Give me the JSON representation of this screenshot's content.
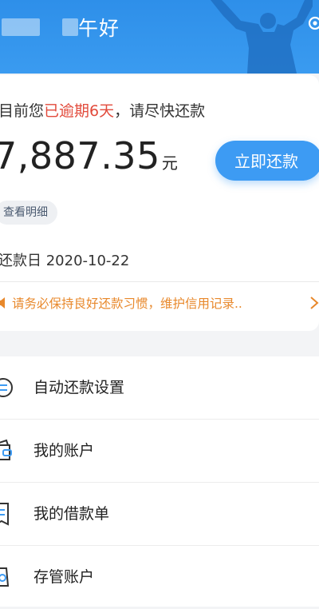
{
  "header": {
    "greeting": "午好"
  },
  "card": {
    "status_prefix": "目前您",
    "status_overdue": "已逾期6天",
    "status_suffix": "，请尽快还款",
    "amount": "7,887.35",
    "amount_unit": "元",
    "pay_button": "立即还款",
    "detail_link": "查看明细",
    "due_date": "还款日 2020-10-22",
    "tip_text": "请务必保持良好还款习惯，维护信用记录.."
  },
  "menu": {
    "items": [
      {
        "label": "自动还款设置",
        "icon": "auto-repay-icon"
      },
      {
        "label": "我的账户",
        "icon": "wallet-icon"
      },
      {
        "label": "我的借款单",
        "icon": "loan-list-icon"
      },
      {
        "label": "存管账户",
        "icon": "custody-account-icon"
      }
    ]
  },
  "colors": {
    "header_blue": "#3a9bf0",
    "button_blue": "#3d9bf3",
    "overdue_red": "#e24a3b",
    "tip_orange": "#e8882b"
  }
}
